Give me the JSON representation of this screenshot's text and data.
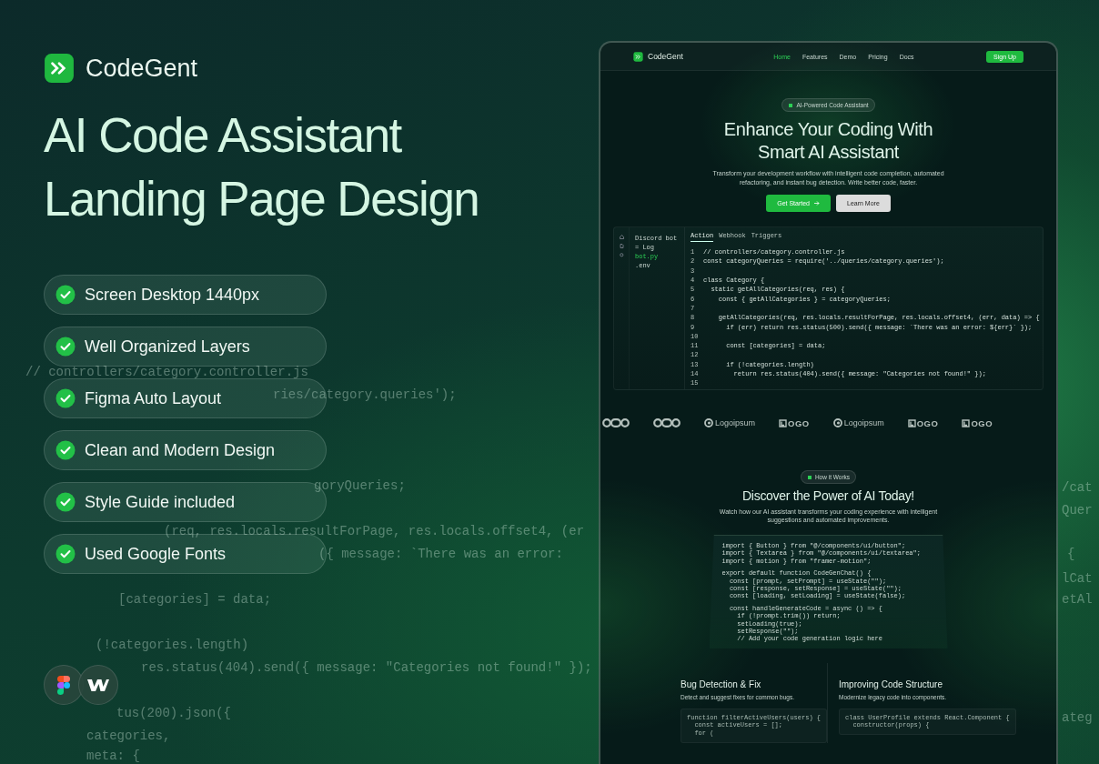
{
  "poster": {
    "brand": "CodeGent",
    "title_lines": [
      "AI Code Assistant",
      "Landing Page Design"
    ],
    "features": [
      "Screen Desktop 1440px",
      "Well Organized Layers",
      "Figma Auto Layout",
      "Clean and Modern Design",
      "Style Guide included",
      "Used Google Fonts"
    ]
  },
  "background_code": [
    "// controllers/category.controller.js",
    "ries/category.queries');",
    "goryQueries;",
    "(req, res.locals.resultForPage, res.locals.offset4, (er",
    "({ message: `There was an error:",
    "[categories] = data;",
    "(!categories.length)",
    "res.status(404).send({ message: \"Categories not found!\" });",
    "tus(200).json({",
    "categories,",
    "meta: {",
    "/cat",
    "Quer",
    "{",
    "lCat",
    "etAl",
    "ateg"
  ],
  "mockup": {
    "nav": {
      "brand": "CodeGent",
      "links": [
        {
          "label": "Home",
          "selected": true
        },
        {
          "label": "Features",
          "selected": false
        },
        {
          "label": "Demo",
          "selected": false
        },
        {
          "label": "Pricing",
          "selected": false
        },
        {
          "label": "Docs",
          "selected": false
        }
      ],
      "cta": "Sign Up"
    },
    "hero": {
      "badge": "AI-Powered Code Assistant",
      "title_lines": [
        "Enhance Your Coding With",
        "Smart AI Assistant"
      ],
      "text": "Transform your development workflow with intelligent code completion, automated refactoring, and instant bug detection. Write better code, faster.",
      "primary": "Get Started",
      "secondary": "Learn More"
    },
    "editor": {
      "files": [
        {
          "name": "Discord bot",
          "selected": false
        },
        {
          "name": "= Log",
          "selected": false
        },
        {
          "name": "bot.py",
          "selected": true
        },
        {
          "name": ".env",
          "selected": false
        }
      ],
      "tabs": [
        {
          "label": "Action",
          "selected": true
        },
        {
          "label": "Webhook",
          "selected": false
        },
        {
          "label": "Triggers",
          "selected": false
        }
      ],
      "lines": [
        {
          "number": "1",
          "code": "// controllers/category.controller.js"
        },
        {
          "number": "2",
          "code": "const categoryQueries = require('../queries/category.queries');"
        },
        {
          "number": "3"
        },
        {
          "number": "4",
          "code": "class Category {"
        },
        {
          "number": "5",
          "code": "  static getAllCategories(req, res) {"
        },
        {
          "number": "6",
          "code": "    const { getAllCategories } = categoryQueries;"
        },
        {
          "number": "7"
        },
        {
          "number": "8",
          "code": "    getAllCategories(req, res.locals.resultForPage, res.locals.offset4, (err, data) => {"
        },
        {
          "number": "9",
          "code": "      if (err) return res.status(500).send({ message: `There was an error: ${err}` });"
        },
        {
          "number": "10"
        },
        {
          "number": "11",
          "code": "      const [categories] = data;"
        },
        {
          "number": "12"
        },
        {
          "number": "13",
          "code": "      if (!categories.length)"
        },
        {
          "number": "14",
          "code": "        return res.status(404).send({ message: \"Categories not found!\" });"
        },
        {
          "number": "15"
        }
      ]
    },
    "logos": [
      {
        "kind": "mark"
      },
      {
        "kind": "mark"
      },
      {
        "kind": "wordmark",
        "text": "Logoipsum"
      },
      {
        "kind": "boxed",
        "text": "OGO"
      },
      {
        "kind": "wordmark",
        "text": "Logoipsum"
      },
      {
        "kind": "boxed",
        "text": "OGO"
      },
      {
        "kind": "boxed",
        "text": "OGO"
      }
    ],
    "how": {
      "badge": "How it Works",
      "title": "Discover the Power of AI Today!",
      "text": "Watch how our AI assistant transforms your coding experience with intelligent suggestions and automated improvements.",
      "code_blocks": [
        [
          "import { Button } from \"@/components/ui/button\";",
          "import { Textarea } from \"@/components/ui/textarea\";",
          "import { motion } from \"framer-motion\";"
        ],
        [
          "export default function CodeGenChat() {",
          "  const [prompt, setPrompt] = useState(\"\");",
          "  const [response, setResponse] = useState(\"\");",
          "  const [loading, setLoading] = useState(false);"
        ],
        [
          "  const handleGenerateCode = async () => {",
          "    if (!prompt.trim()) return;",
          "    setLoading(true);",
          "    setResponse(\"\");",
          "    // Add your code generation logic here"
        ]
      ]
    },
    "cards": [
      {
        "title": "Bug Detection & Fix",
        "text": "Detect and suggest fixes for common bugs.",
        "code": [
          "function filterActiveUsers(users) {",
          "  const activeUsers = [];",
          "  for ("
        ]
      },
      {
        "title": "Improving Code Structure",
        "text": "Modernize legacy code into components.",
        "code": [
          "class UserProfile extends React.Component {",
          "  constructor(props) {"
        ]
      }
    ]
  }
}
